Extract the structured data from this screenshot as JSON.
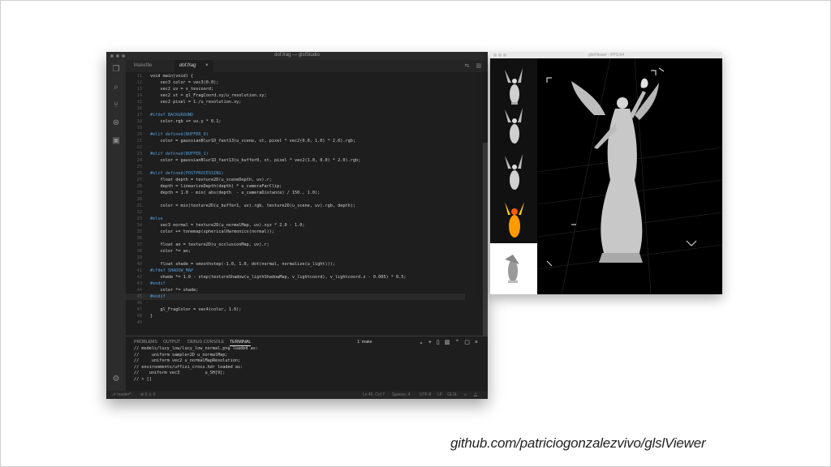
{
  "slide": {
    "caption": "github.com/patriciogonzalezvivo/glslViewer"
  },
  "editor": {
    "window_title": "dof.frag — glslStudio",
    "tabs": [
      {
        "label": "Makefile",
        "active": false
      },
      {
        "label": "dof.frag",
        "active": true
      }
    ],
    "tab_close": "×",
    "code_lines": [
      {
        "n": "11",
        "text": "void main(void) {",
        "pre": false,
        "hl": false
      },
      {
        "n": "12",
        "text": "    vec3 color = vec3(0.0);",
        "pre": false,
        "hl": false
      },
      {
        "n": "13",
        "text": "    vec2 uv = v_texcoord;",
        "pre": false,
        "hl": false
      },
      {
        "n": "14",
        "text": "    vec2 st = gl_FragCoord.xy/u_resolution.xy;",
        "pre": false,
        "hl": false
      },
      {
        "n": "15",
        "text": "    vec2 pixel = 1./u_resolution.xy;",
        "pre": false,
        "hl": false
      },
      {
        "n": "16",
        "text": "",
        "pre": false,
        "hl": false
      },
      {
        "n": "17",
        "text": "#ifdef BACKGROUND",
        "pre": true,
        "hl": false
      },
      {
        "n": "18",
        "text": "    color.rgb += uv.y * 0.1;",
        "pre": false,
        "hl": false
      },
      {
        "n": "19",
        "text": "",
        "pre": false,
        "hl": false
      },
      {
        "n": "20",
        "text": "#elif defined(BUFFER_0)",
        "pre": true,
        "hl": false
      },
      {
        "n": "21",
        "text": "    color = gaussianBlur1D_fast13(u_scene, st, pixel * vec2(0.0, 1.0) * 2.0).rgb;",
        "pre": false,
        "hl": false
      },
      {
        "n": "22",
        "text": "",
        "pre": false,
        "hl": false
      },
      {
        "n": "23",
        "text": "#elif defined(BUFFER_1)",
        "pre": true,
        "hl": false
      },
      {
        "n": "24",
        "text": "    color = gaussianBlur1D_fast13(u_buffer0, st, pixel * vec2(1.0, 0.0) * 2.0).rgb;",
        "pre": false,
        "hl": false
      },
      {
        "n": "25",
        "text": "",
        "pre": false,
        "hl": false
      },
      {
        "n": "26",
        "text": "#elif defined(POSTPROCESSING)",
        "pre": true,
        "hl": false
      },
      {
        "n": "27",
        "text": "    float depth = texture2D(u_sceneDepth, uv).r;",
        "pre": false,
        "hl": false
      },
      {
        "n": "28",
        "text": "    depth = linearizeDepth(depth) * u_cameraFarClip;",
        "pre": false,
        "hl": false
      },
      {
        "n": "29",
        "text": "    depth = 1.0 - min( abs(depth  - u_cameraDistance) / 150., 1.0);",
        "pre": false,
        "hl": false
      },
      {
        "n": "30",
        "text": "",
        "pre": false,
        "hl": false
      },
      {
        "n": "31",
        "text": "    color = mix(texture2D(u_buffer1, uv).rgb, texture2D(u_scene, uv).rgb, depth);",
        "pre": false,
        "hl": false
      },
      {
        "n": "32",
        "text": "",
        "pre": false,
        "hl": false
      },
      {
        "n": "33",
        "text": "#else",
        "pre": true,
        "hl": false
      },
      {
        "n": "34",
        "text": "    vec3 normal = texture2D(u_normalMap, uv).xyz * 2.0 - 1.0;",
        "pre": false,
        "hl": false
      },
      {
        "n": "35",
        "text": "    color += tonemap(sphericalHarmonics(normal));",
        "pre": false,
        "hl": false
      },
      {
        "n": "36",
        "text": "",
        "pre": false,
        "hl": false
      },
      {
        "n": "37",
        "text": "    float ao = texture2D(u_occlusionMap, uv).r;",
        "pre": false,
        "hl": false
      },
      {
        "n": "38",
        "text": "    color *= ao;",
        "pre": false,
        "hl": false
      },
      {
        "n": "39",
        "text": "",
        "pre": false,
        "hl": false
      },
      {
        "n": "40",
        "text": "    float shade = smoothstep(-1.0, 1.0, dot(normal, normalize(u_light)));",
        "pre": false,
        "hl": false
      },
      {
        "n": "41",
        "text": "#ifdef SHADOW_MAP",
        "pre": true,
        "hl": false
      },
      {
        "n": "42",
        "text": "    shade *= 1.0 - step(textureShadow(u_ligthShadowMap, v_lightcoord), v_lightcoord.z - 0.005) * 0.5;",
        "pre": false,
        "hl": false
      },
      {
        "n": "43",
        "text": "#endif",
        "pre": true,
        "hl": false
      },
      {
        "n": "44",
        "text": "    color *= shade;",
        "pre": false,
        "hl": false
      },
      {
        "n": "45",
        "text": "#endif",
        "pre": true,
        "hl": true
      },
      {
        "n": "46",
        "text": "",
        "pre": false,
        "hl": false
      },
      {
        "n": "47",
        "text": "    gl_FragColor = vec4(color, 1.0);",
        "pre": false,
        "hl": false
      },
      {
        "n": "48",
        "text": "}",
        "pre": false,
        "hl": false
      },
      {
        "n": "49",
        "text": "",
        "pre": false,
        "hl": false
      }
    ],
    "panel": {
      "tabs": [
        {
          "label": "PROBLEMS",
          "active": false
        },
        {
          "label": "OUTPUT",
          "active": false
        },
        {
          "label": "DEBUG CONSOLE",
          "active": false
        },
        {
          "label": "TERMINAL",
          "active": true
        }
      ],
      "terminal_select": "1: make",
      "terminal_lines": [
        "// models/lucy_low/lucy_low_normal.png loaded as:",
        "//     uniform sampler2D u_normalMap;",
        "//     uniform vec2 u_normalMapResolution;",
        "// environments/uffizi_cross.hdr loaded as:",
        "//    uniform vec3          u_SH[9];",
        "// > []"
      ]
    },
    "status": {
      "left": "⎇ master*",
      "problems": "⊗ 0 ⚠ 0",
      "position": "Ln 45, Col 7",
      "spaces": "Spaces: 4",
      "encoding": "UTF-8",
      "eol": "LF",
      "language": "GLSL"
    }
  },
  "viewer": {
    "window_title": "glslViewer - FPS:64"
  }
}
